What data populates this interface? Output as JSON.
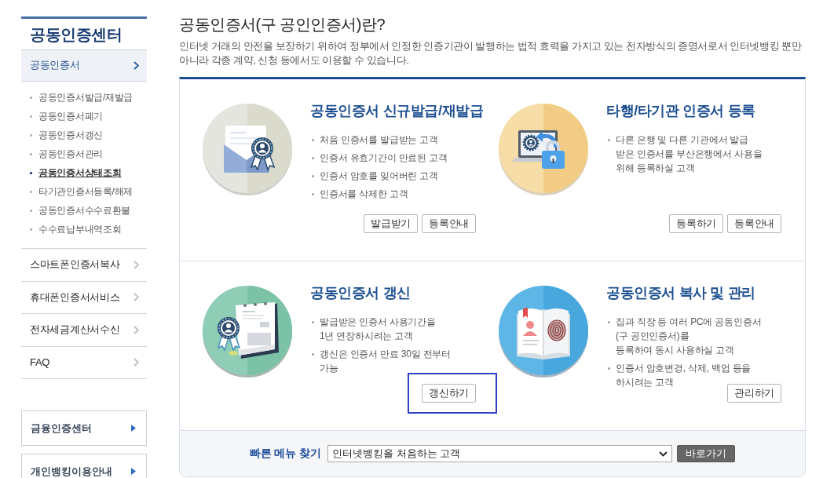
{
  "sidebar": {
    "title": "공동인증센터",
    "menu": [
      {
        "label": "공동인증서",
        "expanded": true,
        "children": [
          {
            "label": "공동인증서발급/재발급",
            "selected": false
          },
          {
            "label": "공동인증서폐기",
            "selected": false
          },
          {
            "label": "공동인증서갱신",
            "selected": false
          },
          {
            "label": "공동인증서관리",
            "selected": false
          },
          {
            "label": "공동인증서상태조회",
            "selected": true
          },
          {
            "label": "타기관인증서등록/해제",
            "selected": false
          },
          {
            "label": "공동인증서수수료환불",
            "selected": false
          },
          {
            "label": "수수료납부내역조회",
            "selected": false
          }
        ]
      },
      {
        "label": "스마트폰인증서복사",
        "expanded": false
      },
      {
        "label": "휴대폰인증서서비스",
        "expanded": false
      },
      {
        "label": "전자세금계산서수신",
        "expanded": false
      },
      {
        "label": "FAQ",
        "expanded": false
      }
    ],
    "shortcuts": [
      "금융인증센터",
      "개인뱅킹이용안내"
    ]
  },
  "intro": {
    "title": "공동인증서(구 공인인증서)란?",
    "description": "인터넷 거래의 안전을 보장하기 위하여 정부에서 인정한 인증기관이 발행하는 법적 효력을 가지고 있는 전자방식의 증명서로서 인터넷뱅킹 뿐만 아니라 각종 계약, 신청 등에서도 이용할 수 있습니다."
  },
  "services": [
    {
      "title": "공동인증서 신규발급/재발급",
      "bullets": [
        "처음 인증서를 발급받는 고객",
        "인증서 유효기간이 만료된 고객",
        "인증서 암호를 잊어버린 고객",
        "인증서를 삭제한 고객"
      ],
      "buttons": [
        {
          "label": "발급받기",
          "highlighted": false
        },
        {
          "label": "등록안내",
          "highlighted": false
        }
      ]
    },
    {
      "title": "타행/타기관 인증서 등록",
      "bullets": [
        "다른 은행 및 다른 기관에서 발급\n받은 인증서를 부산은행에서 사용을\n위해 등록하실 고객"
      ],
      "buttons": [
        {
          "label": "등록하기",
          "highlighted": false
        },
        {
          "label": "등록안내",
          "highlighted": false
        }
      ]
    },
    {
      "title": "공동인증서 갱신",
      "bullets": [
        "발급받은 인증서 사용기간을\n1년 연장하시려는 고객",
        "갱신은 인증서 만료 30일 전부터\n가능"
      ],
      "buttons": [
        {
          "label": "갱신하기",
          "highlighted": true
        }
      ]
    },
    {
      "title": "공동인증서 복사 및 관리",
      "bullets": [
        "집과 직장 등 여러 PC에 공동인증서\n(구 공인인증서)를\n등록하여 동시 사용하실 고객",
        "인증서 암호변경, 삭제, 백업 등을\n하시려는 고객"
      ],
      "buttons": [
        {
          "label": "관리하기",
          "highlighted": false
        }
      ]
    }
  ],
  "quick_menu": {
    "label": "빠른 메뉴 찾기",
    "select_value": "인터넷뱅킹을 처음하는 고객",
    "button": "바로가기"
  }
}
